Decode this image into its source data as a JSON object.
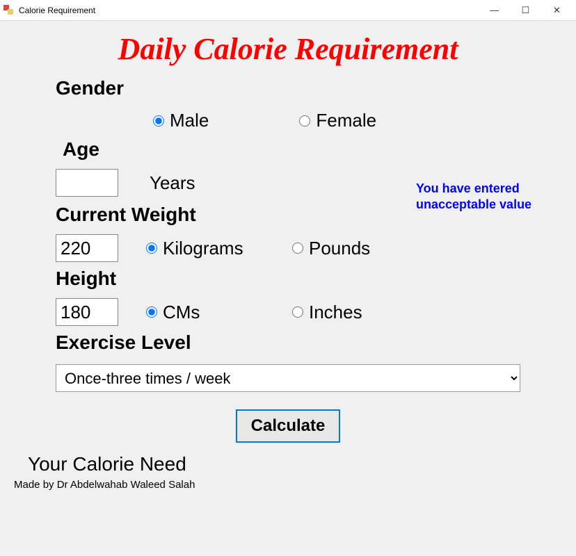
{
  "window": {
    "title": "Calorie Requirement"
  },
  "heading": "Daily Calorie Requirement",
  "gender": {
    "label": "Gender",
    "male": "Male",
    "female": "Female",
    "selected": "male"
  },
  "age": {
    "label": "Age",
    "value": "",
    "unit": "Years"
  },
  "error": "You have entered unacceptable value",
  "weight": {
    "label": "Current Weight",
    "value": "220",
    "kg": "Kilograms",
    "lb": "Pounds",
    "selected": "kg"
  },
  "height": {
    "label": "Height",
    "value": "180",
    "cm": "CMs",
    "in": "Inches",
    "selected": "cm"
  },
  "exercise": {
    "label": "Exercise Level",
    "selected": "Once-three times / week"
  },
  "calculate": "Calculate",
  "result_label": "Your Calorie Need",
  "footer": "Made by Dr Abdelwahab Waleed Salah"
}
